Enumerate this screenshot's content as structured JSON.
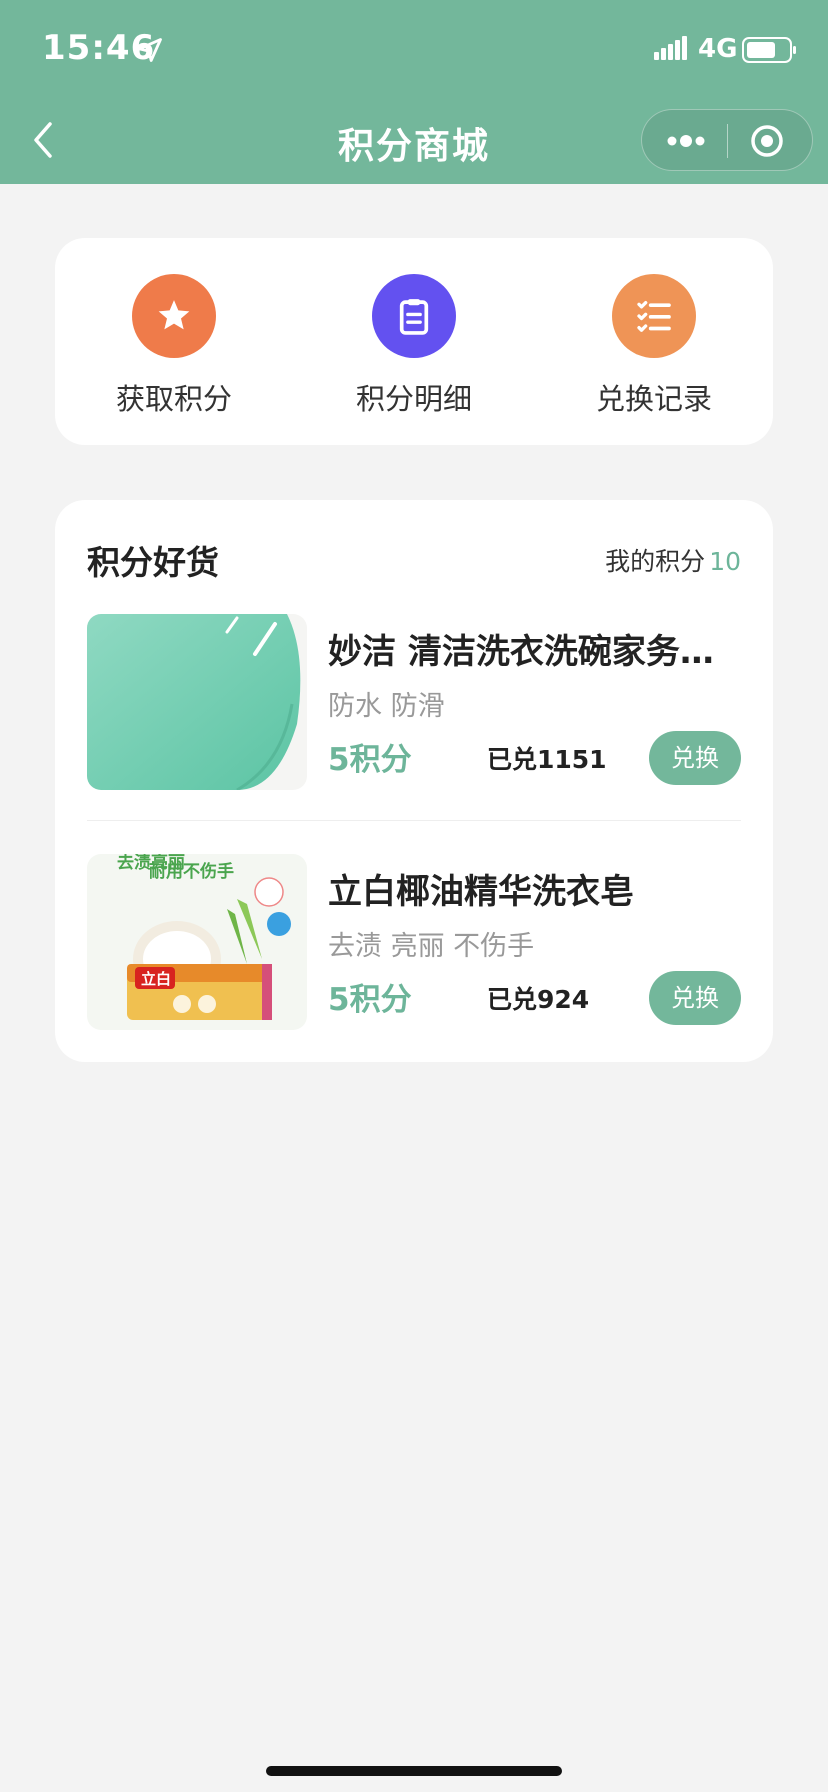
{
  "status_bar": {
    "time": "15:46",
    "network": "4G"
  },
  "nav": {
    "title": "积分商城"
  },
  "actions": [
    {
      "label": "获取积分",
      "icon": "star-icon",
      "color": "#ef7b4a"
    },
    {
      "label": "积分明细",
      "icon": "clipboard-icon",
      "color": "#6351f0"
    },
    {
      "label": "兑换记录",
      "icon": "checklist-icon",
      "color": "#ef9456"
    }
  ],
  "goods": {
    "title": "积分好货",
    "points_label": "我的积分",
    "points_value": "10",
    "items": [
      {
        "name": "妙洁 清洁洗衣洗碗家务…",
        "tags": "防水 防滑",
        "price": "5积分",
        "sold": "已兑1151",
        "button": "兑换"
      },
      {
        "name": "立白椰油精华洗衣皂",
        "tags": "去渍 亮丽 不伤手",
        "price": "5积分",
        "sold": "已兑924",
        "button": "兑换",
        "image_text": {
          "top": "去渍亮丽",
          "slogan": "耐用不伤手",
          "brand": "立白"
        }
      }
    ]
  },
  "colors": {
    "primary": "#73b79b",
    "accent_text": "#6db59a",
    "background": "#f3f3f3"
  }
}
